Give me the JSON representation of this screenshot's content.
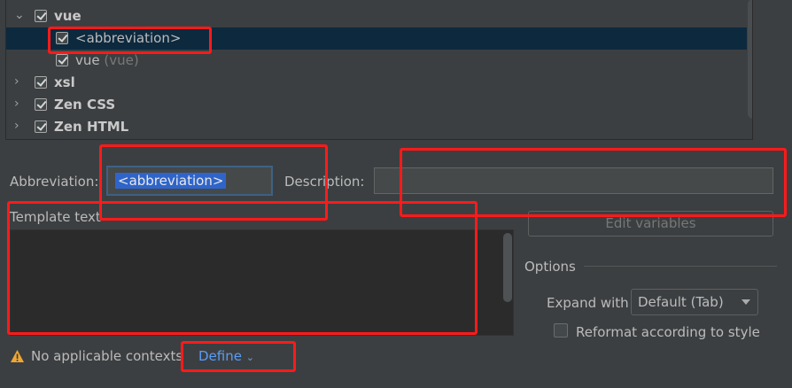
{
  "tree": {
    "items": [
      {
        "label": "vue",
        "bold": true,
        "expanded": true,
        "checked": true
      },
      {
        "label": "<abbreviation>",
        "selected": true,
        "checked": true
      },
      {
        "label": "vue",
        "hint": "(vue)",
        "checked": true
      },
      {
        "label": "xsl",
        "bold": true,
        "checked": true
      },
      {
        "label": "Zen CSS",
        "bold": true,
        "checked": true
      },
      {
        "label": "Zen HTML",
        "bold": true,
        "checked": true
      }
    ]
  },
  "form": {
    "abbreviation_label": "Abbreviation:",
    "abbreviation_value": "<abbreviation>",
    "description_label": "Description:",
    "description_value": "",
    "template_text_label": "Template text",
    "template_text_value": "",
    "edit_variables_label": "Edit variables",
    "options_label": "Options",
    "expand_with_label": "Expand with",
    "expand_with_value": "Default (Tab)",
    "reformat_label": "Reformat according to style",
    "reformat_checked": false
  },
  "footer": {
    "warning_text": "No applicable contexts",
    "define_label": "Define"
  },
  "colors": {
    "background": "#3c3f41",
    "selection": "#0d293e",
    "link": "#589df6",
    "highlight_box": "#ff1a1a",
    "warning": "#f0a732"
  }
}
